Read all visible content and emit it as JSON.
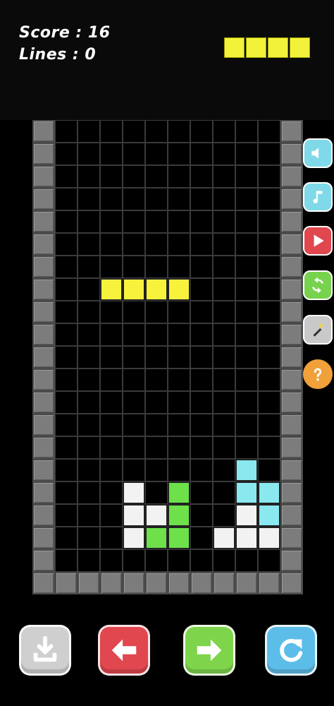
{
  "hud": {
    "score_text": "Score : 16",
    "lines_text": "Lines : 0",
    "next_piece_color": "#f2f23a",
    "next_piece_cells": 4
  },
  "board": {
    "cols": 10,
    "rows": 20,
    "colors": {
      "Y": "#f7f33d",
      "W": "#f2f2f2",
      "G": "#6de04a",
      "C": "#8ae8ef",
      "wall": "#7c7c7c"
    },
    "falling_piece": {
      "color": "Y",
      "cells": [
        [
          7,
          3
        ],
        [
          7,
          4
        ],
        [
          7,
          5
        ],
        [
          7,
          6
        ]
      ]
    },
    "locked_cells": [
      [
        16,
        4,
        "W"
      ],
      [
        17,
        4,
        "W"
      ],
      [
        17,
        5,
        "W"
      ],
      [
        18,
        4,
        "W"
      ],
      [
        16,
        6,
        "G"
      ],
      [
        17,
        6,
        "G"
      ],
      [
        18,
        5,
        "G"
      ],
      [
        18,
        6,
        "G"
      ],
      [
        15,
        9,
        "C"
      ],
      [
        16,
        9,
        "C"
      ],
      [
        16,
        10,
        "C"
      ],
      [
        17,
        10,
        "C"
      ],
      [
        17,
        9,
        "W"
      ],
      [
        18,
        8,
        "W"
      ],
      [
        18,
        9,
        "W"
      ],
      [
        18,
        10,
        "W"
      ]
    ]
  },
  "side_menu": [
    {
      "name": "sound-button",
      "icon": "speaker-icon",
      "color": "#7fd9e8"
    },
    {
      "name": "music-button",
      "icon": "music-note-icon",
      "color": "#7fd9e8"
    },
    {
      "name": "play-button",
      "icon": "play-icon",
      "color": "#e0474f"
    },
    {
      "name": "restart-button",
      "icon": "refresh-icon",
      "color": "#77d34d"
    },
    {
      "name": "magic-button",
      "icon": "magic-wand-icon",
      "color": "#c9c9c9"
    },
    {
      "name": "help-button",
      "icon": "question-icon",
      "color": "#f0a13a"
    }
  ],
  "controls": [
    {
      "name": "drop-button",
      "icon": "drop-icon",
      "color": "#cfcfcf"
    },
    {
      "name": "move-left-button",
      "icon": "arrow-left-icon",
      "color": "#e0474f"
    },
    {
      "name": "move-right-button",
      "icon": "arrow-right-icon",
      "color": "#7ed54c"
    },
    {
      "name": "rotate-button",
      "icon": "rotate-icon",
      "color": "#5dbde9"
    }
  ]
}
